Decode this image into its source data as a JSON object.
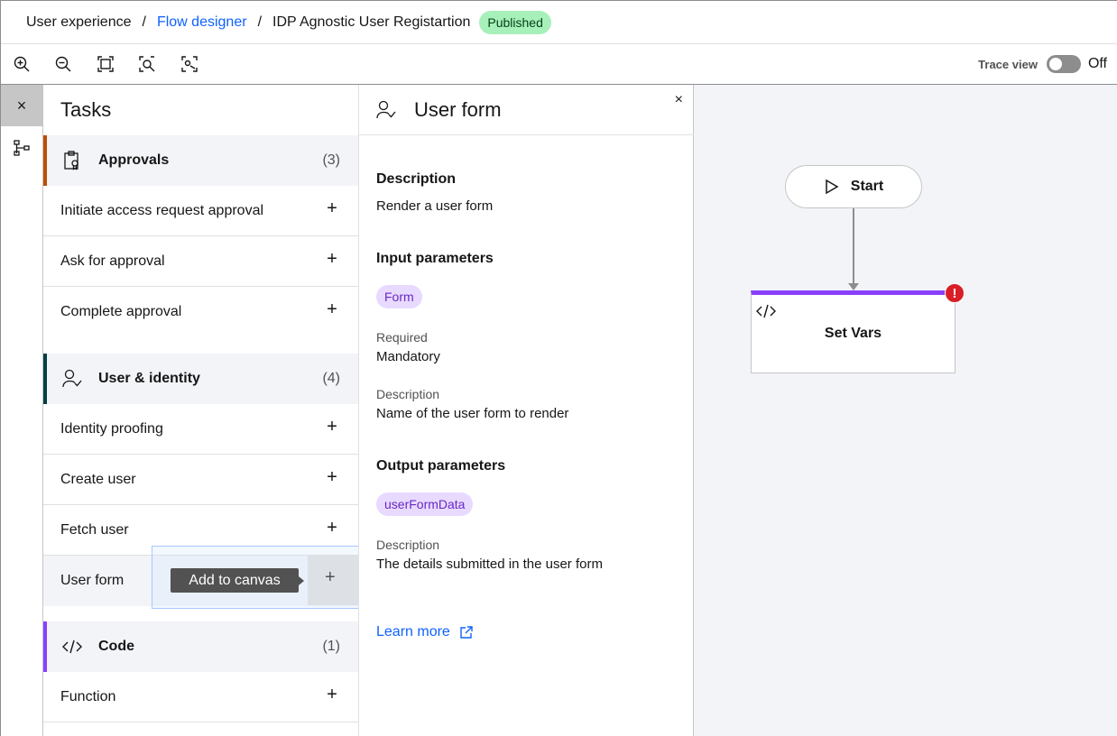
{
  "breadcrumb": {
    "items": [
      "User experience",
      "Flow designer",
      "IDP Agnostic User Registartion"
    ],
    "status": "Published"
  },
  "toolbar": {
    "icons": [
      "zoom-in-icon",
      "zoom-out-icon",
      "fit-to-screen-icon",
      "zoom-area-icon",
      "center-view-icon"
    ],
    "trace_label": "Trace view",
    "trace_state": "Off"
  },
  "rail": {
    "close": "×"
  },
  "tasks": {
    "title": "Tasks",
    "categories": [
      {
        "name": "Approvals",
        "count": "(3)",
        "color": "#ba4e00",
        "icon": "clipboard-approval-icon",
        "items": [
          "Initiate access request approval",
          "Ask for approval",
          "Complete approval"
        ]
      },
      {
        "name": "User & identity",
        "count": "(4)",
        "color": "#004144",
        "icon": "user-check-icon",
        "items": [
          "Identity proofing",
          "Create user",
          "Fetch user",
          "User form"
        ]
      },
      {
        "name": "Code",
        "count": "(1)",
        "color": "#8a3ffc",
        "icon": "code-icon",
        "items": [
          "Function"
        ]
      }
    ],
    "plus": "+",
    "tooltip": "Add to canvas"
  },
  "detail": {
    "title": "User form",
    "close": "×",
    "description_heading": "Description",
    "description": "Render a user form",
    "input_heading": "Input parameters",
    "input_tag": "Form",
    "required_label": "Required",
    "required_value": "Mandatory",
    "input_desc_label": "Description",
    "input_desc": "Name of the user form to render",
    "output_heading": "Output parameters",
    "output_tag": "userFormData",
    "output_desc_label": "Description",
    "output_desc": "The details submitted in the user form",
    "learn_more": "Learn more"
  },
  "canvas": {
    "start_label": "Start",
    "node_label": "Set Vars",
    "error_mark": "!"
  }
}
